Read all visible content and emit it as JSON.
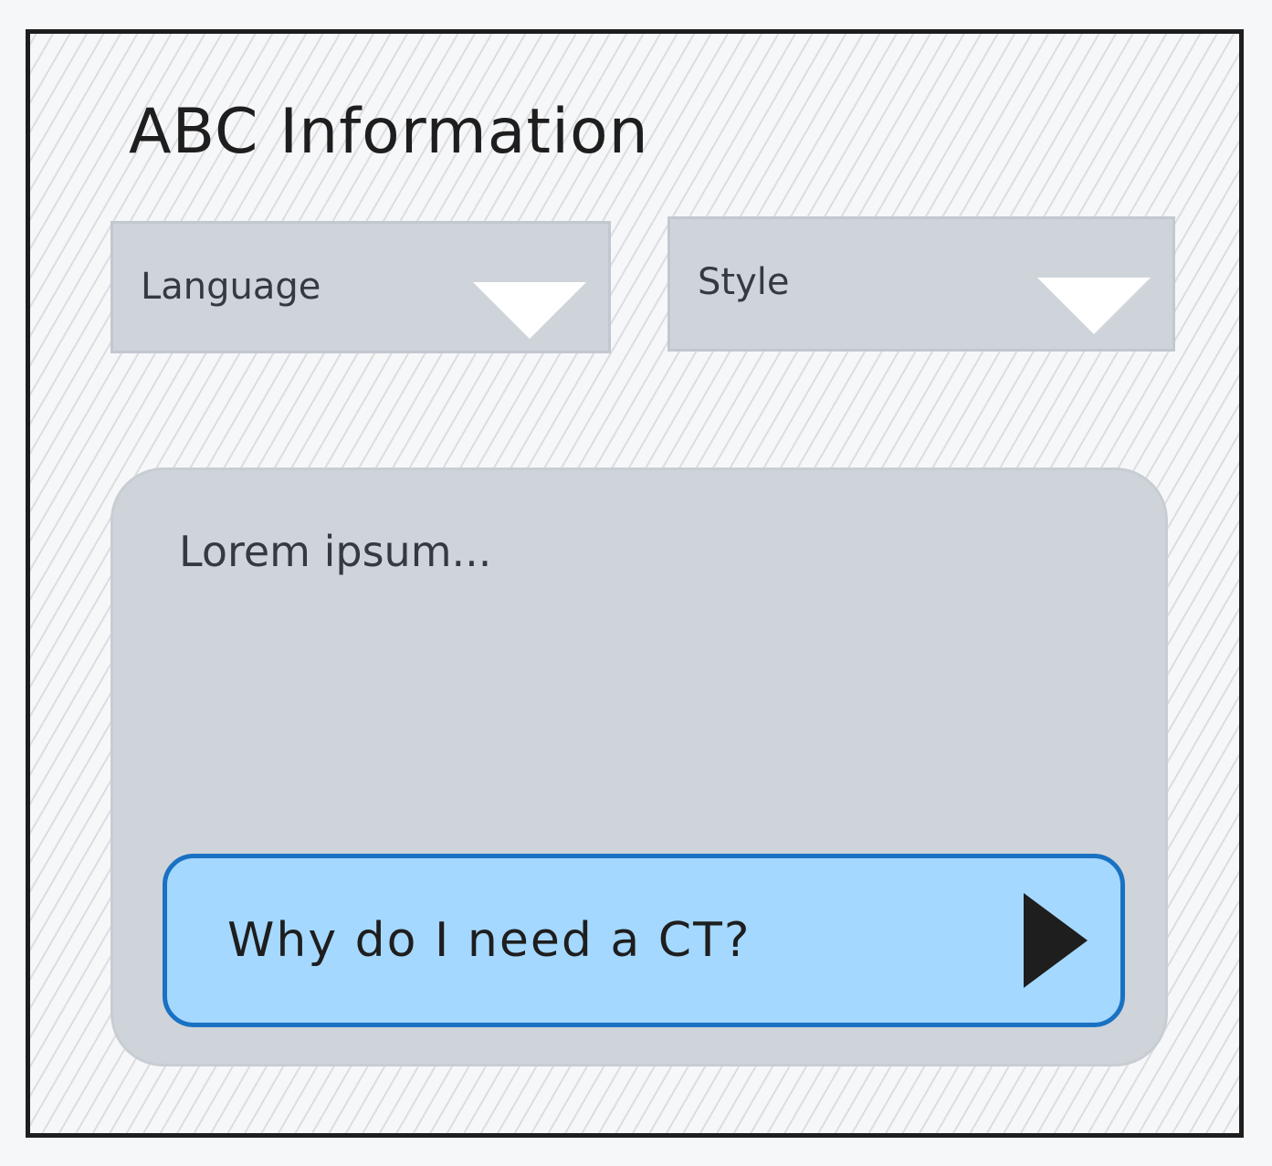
{
  "title": "ABC Information",
  "dropdowns": [
    {
      "label": "Language",
      "icon": "chevron-down-icon"
    },
    {
      "label": "Style",
      "icon": "chevron-down-icon"
    }
  ],
  "content": {
    "text": "Lorem ipsum..."
  },
  "ask_button": {
    "label": "Why do I need a CT?",
    "icon": "send-icon"
  },
  "colors": {
    "background": "#f6f7f9",
    "border": "#1e1e1e",
    "panel": "#ced4da",
    "button_fill": "#a5d8ff",
    "button_border": "#1971c2",
    "arrow": "#ffffff"
  }
}
